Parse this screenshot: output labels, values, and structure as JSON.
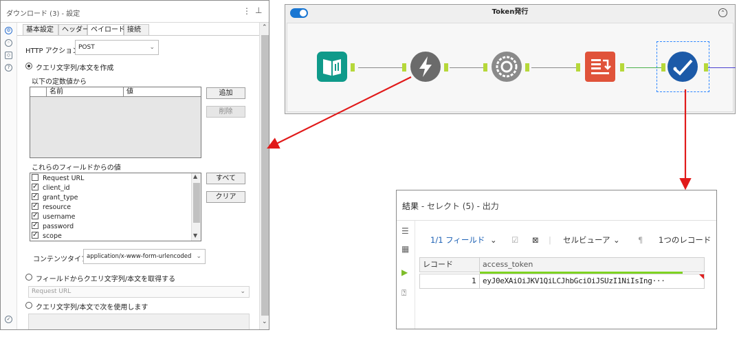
{
  "config": {
    "title": "ダウンロード (3) - 設定",
    "tabs": [
      "基本設定",
      "ヘッダー",
      "ペイロード",
      "接続"
    ],
    "selected_tab": "ペイロード",
    "http_action_label": "HTTP アクション",
    "http_action_value": "POST",
    "radio_compose": "クエリ文字列/本文を作成",
    "const_values_label": "以下の定数値から",
    "const_table_headers": [
      "名前",
      "値"
    ],
    "add_button": "追加",
    "delete_button": "削除",
    "field_values_label": "これらのフィールドからの値",
    "fields": [
      {
        "name": "Request URL",
        "checked": false
      },
      {
        "name": "client_id",
        "checked": true
      },
      {
        "name": "grant_type",
        "checked": true
      },
      {
        "name": "resource",
        "checked": true
      },
      {
        "name": "username",
        "checked": true
      },
      {
        "name": "password",
        "checked": true
      },
      {
        "name": "scope",
        "checked": true
      }
    ],
    "all_button": "すべて",
    "clear_button": "クリア",
    "content_type_label": "コンテンツタイプ",
    "content_type_value": "application/x-www-form-urlencoded",
    "radio_from_field": "フィールドからクエリ文字列/本文を取得する",
    "from_field_select": "Request URL",
    "radio_use_following": "クエリ文字列/本文で次を使用します"
  },
  "workflow": {
    "container_title": "Token発行",
    "collapse_glyph": "⌃"
  },
  "results": {
    "title_prefix": "結果",
    "title_rest": " - セレクト (5) - 出力",
    "field_count": "1/1 フィールド",
    "cell_viewer": "セルビューア",
    "record_count": "1つのレコード",
    "columns": [
      "レコード",
      "access_token"
    ],
    "rows": [
      {
        "record": "1",
        "access_token": "eyJ0eXAiOiJKV1QiLCJhbGciOiJSUzI1NiIsIng···"
      }
    ]
  },
  "colors": {
    "arrow": "#e11a1a",
    "anchor": "#b6d83a",
    "input_tool": "#0f9a8a",
    "download_tool": "#6b6b6b",
    "formula_tool": "#8a8a8a",
    "text_to_columns": "#e0533a",
    "select_tool": "#1c5aa8"
  }
}
